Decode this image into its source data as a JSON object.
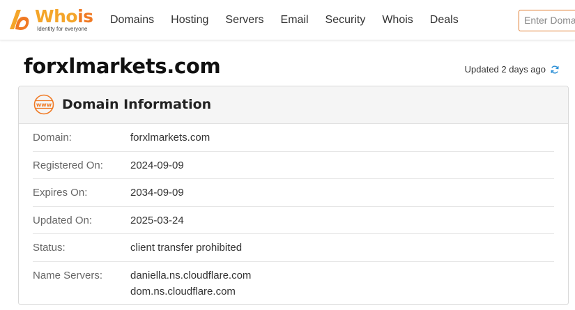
{
  "header": {
    "logo": {
      "word_a": "Who",
      "word_b": "is",
      "tagline": "Identity for everyone"
    },
    "nav": [
      "Domains",
      "Hosting",
      "Servers",
      "Email",
      "Security",
      "Whois",
      "Deals"
    ],
    "search_placeholder": "Enter Domain"
  },
  "title": "forxlmarkets.com",
  "updated_text": "Updated 2 days ago",
  "card": {
    "title": "Domain Information",
    "icon_text": "www",
    "rows": [
      {
        "label": "Domain:",
        "values": [
          "forxlmarkets.com"
        ]
      },
      {
        "label": "Registered On:",
        "values": [
          "2024-09-09"
        ]
      },
      {
        "label": "Expires On:",
        "values": [
          "2034-09-09"
        ]
      },
      {
        "label": "Updated On:",
        "values": [
          "2025-03-24"
        ]
      },
      {
        "label": "Status:",
        "values": [
          "client transfer prohibited"
        ]
      },
      {
        "label": "Name Servers:",
        "values": [
          "daniella.ns.cloudflare.com",
          "dom.ns.cloudflare.com"
        ]
      }
    ]
  },
  "colors": {
    "brand_orange": "#f07a24",
    "brand_yellow": "#f4a52a",
    "refresh_blue": "#2a8fd6"
  },
  "icons": [
    "logo-mark-icon",
    "www-globe-icon",
    "refresh-icon"
  ]
}
